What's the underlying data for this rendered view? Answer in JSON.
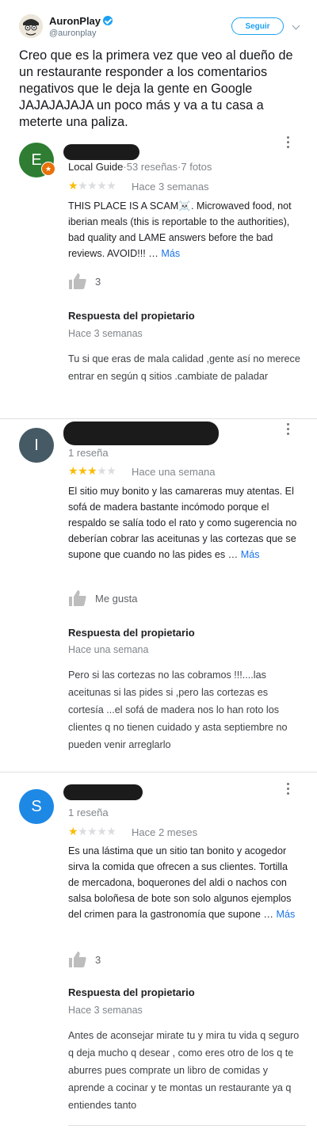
{
  "tweet": {
    "name": "AuronPlay",
    "handle": "@auronplay",
    "follow_label": "Seguir",
    "text": "Creo que es la primera vez que veo al dueño de un restaurante responder a los comentarios negativos que le deja la gente en Google JAJAJAJAJA un poco más y va a tu casa a meterte una paliza."
  },
  "reviews": [
    {
      "avatar_letter": "E",
      "avatar_color": "#2e7d32",
      "meta_title": "Local Guide",
      "meta_stats": "·53 reseñas·7 fotos",
      "rating": 1,
      "date": "Hace 3 semanas",
      "text": "THIS PLACE IS A SCAM☠️. Microwaved food, not iberian meals (this is reportable to the authorities), bad quality and LAME answers before the bad reviews. AVOID!!! …",
      "more_label": "Más",
      "like_text": "3",
      "owner_title": "Respuesta del propietario",
      "owner_date": "Hace 3 semanas",
      "owner_text": "Tu si que eras de mala calidad ,gente así no merece entrar en según q sitios .cambiate de paladar"
    },
    {
      "avatar_letter": "I",
      "avatar_color": "#455a64",
      "meta_stats": "1 reseña",
      "rating": 3,
      "date": "Hace una semana",
      "text": "El sitio muy bonito y las camareras muy atentas. El sofá de madera bastante incómodo porque el respaldo se salía todo el rato y como sugerencia no deberían cobrar las aceitunas y las cortezas que se supone que cuando no las pides es …",
      "more_label": "Más",
      "like_text": "Me gusta",
      "owner_title": "Respuesta del propietario",
      "owner_date": "Hace una semana",
      "owner_text": "Pero si las cortezas no las cobramos !!!....las aceitunas si las pides si ,pero las cortezas es cortesía ...el sofá de madera nos lo han roto los clientes q no tienen cuidado y asta septiembre no pueden venir arreglarlo"
    },
    {
      "avatar_letter": "S",
      "avatar_color": "#1e88e5",
      "meta_stats": "1 reseña",
      "rating": 1,
      "date": "Hace 2 meses",
      "text": "Es una lástima que un sitio tan bonito y acogedor sirva la comida que ofrecen a sus clientes. Tortilla de mercadona, boquerones del aldi o nachos con salsa boloñesa de bote son solo algunos ejemplos del crimen para la gastronomía que supone …",
      "more_label": "Más",
      "like_text": "3",
      "owner_title": "Respuesta del propietario",
      "owner_date": "Hace 3 semanas",
      "owner_text": "Antes de aconsejar mirate tu y mira tu vida q seguro q deja mucho q desear , como eres otro de los q te aburres pues comprate un libro de comidas y aprende a cocinar y te montas un restaurante ya q entiendes tanto"
    }
  ]
}
